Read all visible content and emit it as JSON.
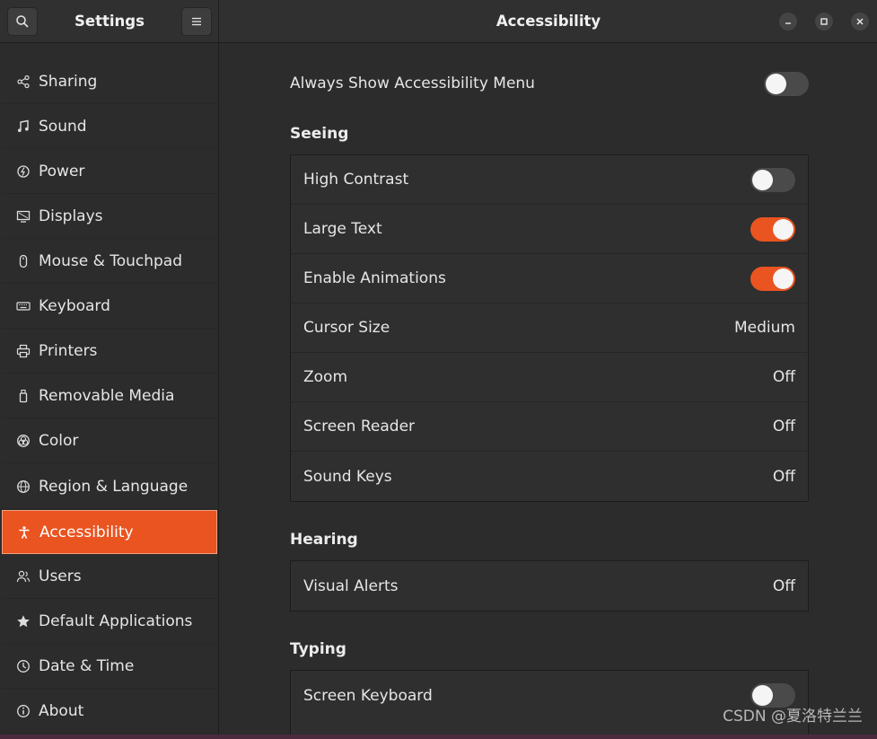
{
  "header": {
    "sidebar_title": "Settings",
    "main_title": "Accessibility",
    "icons": {
      "search": "search-icon",
      "menu": "hamburger-menu-icon",
      "minimize": "minimize-icon",
      "maximize": "maximize-icon",
      "close": "close-icon"
    }
  },
  "sidebar": {
    "items": [
      {
        "label": "Sharing",
        "icon": "share-icon"
      },
      {
        "label": "Sound",
        "icon": "music-note-icon"
      },
      {
        "label": "Power",
        "icon": "power-icon"
      },
      {
        "label": "Displays",
        "icon": "display-icon"
      },
      {
        "label": "Mouse & Touchpad",
        "icon": "mouse-icon"
      },
      {
        "label": "Keyboard",
        "icon": "keyboard-icon"
      },
      {
        "label": "Printers",
        "icon": "printer-icon"
      },
      {
        "label": "Removable Media",
        "icon": "usb-drive-icon"
      },
      {
        "label": "Color",
        "icon": "color-icon"
      },
      {
        "label": "Region & Language",
        "icon": "globe-icon"
      },
      {
        "label": "Accessibility",
        "icon": "accessibility-icon",
        "active": true
      },
      {
        "label": "Users",
        "icon": "users-icon"
      },
      {
        "label": "Default Applications",
        "icon": "star-icon"
      },
      {
        "label": "Date & Time",
        "icon": "clock-icon"
      },
      {
        "label": "About",
        "icon": "info-icon"
      }
    ]
  },
  "main": {
    "always_show_menu": {
      "label": "Always Show Accessibility Menu",
      "enabled": false
    },
    "seeing": {
      "title": "Seeing",
      "high_contrast": {
        "label": "High Contrast",
        "enabled": false
      },
      "large_text": {
        "label": "Large Text",
        "enabled": true
      },
      "enable_animations": {
        "label": "Enable Animations",
        "enabled": true
      },
      "cursor_size": {
        "label": "Cursor Size",
        "value": "Medium"
      },
      "zoom": {
        "label": "Zoom",
        "value": "Off"
      },
      "screen_reader": {
        "label": "Screen Reader",
        "value": "Off"
      },
      "sound_keys": {
        "label": "Sound Keys",
        "value": "Off"
      }
    },
    "hearing": {
      "title": "Hearing",
      "visual_alerts": {
        "label": "Visual Alerts",
        "value": "Off"
      }
    },
    "typing": {
      "title": "Typing",
      "screen_keyboard": {
        "label": "Screen Keyboard",
        "enabled": false
      }
    }
  },
  "watermark": "CSDN @夏洛特兰兰",
  "colors": {
    "accent": "#e95420",
    "background": "#2c2c2c",
    "header": "#303030"
  }
}
